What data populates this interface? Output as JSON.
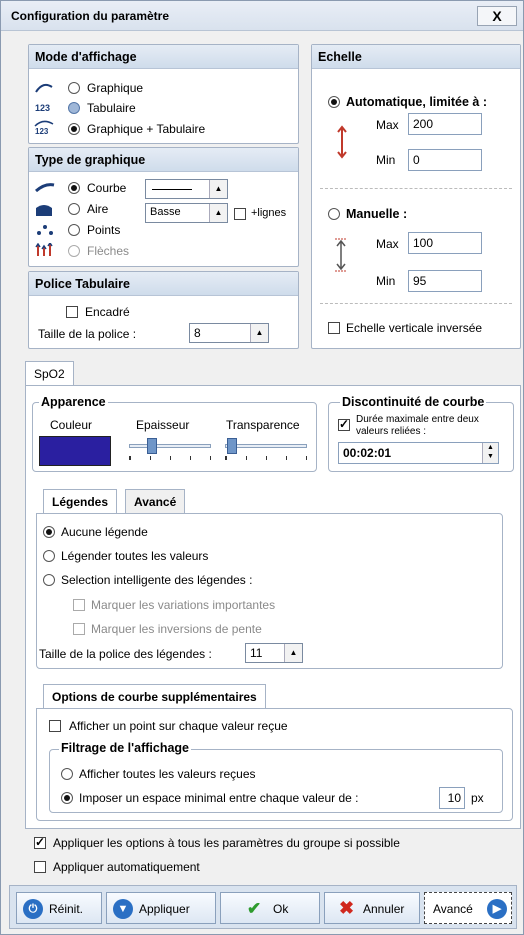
{
  "title": "Configuration du paramètre",
  "close_label": "X",
  "mode": {
    "header": "Mode d'affichage",
    "options": [
      "Graphique",
      "Tabulaire",
      "Graphique + Tabulaire"
    ],
    "icon_labels": [
      "",
      "123",
      "123"
    ]
  },
  "echelle": {
    "header": "Echelle",
    "auto_label": "Automatique, limitée à :",
    "auto_max_label": "Max",
    "auto_max": "200",
    "auto_min_label": "Min",
    "auto_min": "0",
    "manual_label": "Manuelle :",
    "man_max_label": "Max",
    "man_max": "100",
    "man_min_label": "Min",
    "man_min": "95",
    "inverse_label": "Echelle verticale inversée"
  },
  "type": {
    "header": "Type de graphique",
    "options": [
      "Courbe",
      "Aire",
      "Points",
      "Flèches"
    ],
    "aire_select": "Basse",
    "lines_label": "+lignes"
  },
  "police": {
    "header": "Police Tabulaire",
    "encadre": "Encadré",
    "size_label": "Taille de la police :",
    "size": "8"
  },
  "tab_main": "SpO2",
  "apparence": {
    "legend": "Apparence",
    "couleur": "Couleur",
    "epaisseur": "Epaisseur",
    "transparence": "Transparence",
    "color_hex": "#2a1fa0"
  },
  "discontinuite": {
    "legend": "Discontinuité de courbe",
    "label": "Durée maximale entre deux valeurs reliées :",
    "value": "00:02:01"
  },
  "subtabs": [
    "Légendes",
    "Avancé"
  ],
  "legendes": {
    "options": [
      "Aucune légende",
      "Légender toutes les valeurs",
      "Selection intelligente des légendes :"
    ],
    "sub": [
      "Marquer les variations importantes",
      "Marquer les inversions de pente"
    ],
    "size_label": "Taille de la police des légendes :",
    "size": "11"
  },
  "options_tab": "Options de courbe supplémentaires",
  "options": {
    "point_label": "Afficher un point sur chaque valeur reçue",
    "filtrage_legend": "Filtrage de l'affichage",
    "all_label": "Afficher toutes les valeurs reçues",
    "min_label": "Imposer un espace minimal entre chaque valeur de :",
    "min_value": "10",
    "unit": "px"
  },
  "apply_all": "Appliquer les options à tous les paramètres du groupe si possible",
  "apply_auto": "Appliquer automatiquement",
  "buttons": {
    "reinit": "Réinit.",
    "appliquer": "Appliquer",
    "ok": "Ok",
    "annuler": "Annuler",
    "avance": "Avancé"
  }
}
